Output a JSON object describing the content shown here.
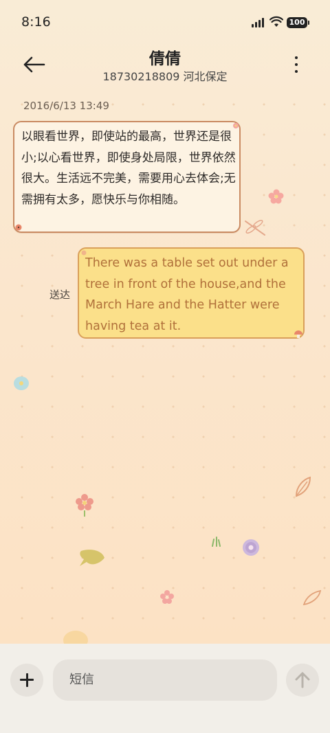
{
  "status_bar": {
    "time": "8:16",
    "battery": "100"
  },
  "header": {
    "contact_name": "倩倩",
    "subtitle": "18730218809 河北保定"
  },
  "conversation": {
    "timestamp": "2016/6/13 13:49",
    "incoming_message": "以眼看世界，即使站的最高，世界还是很小;以心看世界，即使身处局限，世界依然很大。生活远不完美，需要用心去体会;无需拥有太多，愿快乐与你相随。",
    "outgoing_message": "There was a table set out under a tree in front of the house,and the March Hare and the Hatter were having tea at it.",
    "delivery_status": "送达"
  },
  "composer": {
    "placeholder": "短信"
  },
  "colors": {
    "incoming_bubble_bg": "#fdf3e3",
    "incoming_bubble_border": "#c98a62",
    "outgoing_bubble_bg": "#fbe08a",
    "outgoing_bubble_border": "#d99f5a",
    "outgoing_text": "#b0703a"
  },
  "icons": [
    "back-arrow-icon",
    "more-vertical-icon",
    "plus-icon",
    "send-arrow-icon",
    "signal-icon",
    "wifi-icon",
    "battery-icon"
  ]
}
